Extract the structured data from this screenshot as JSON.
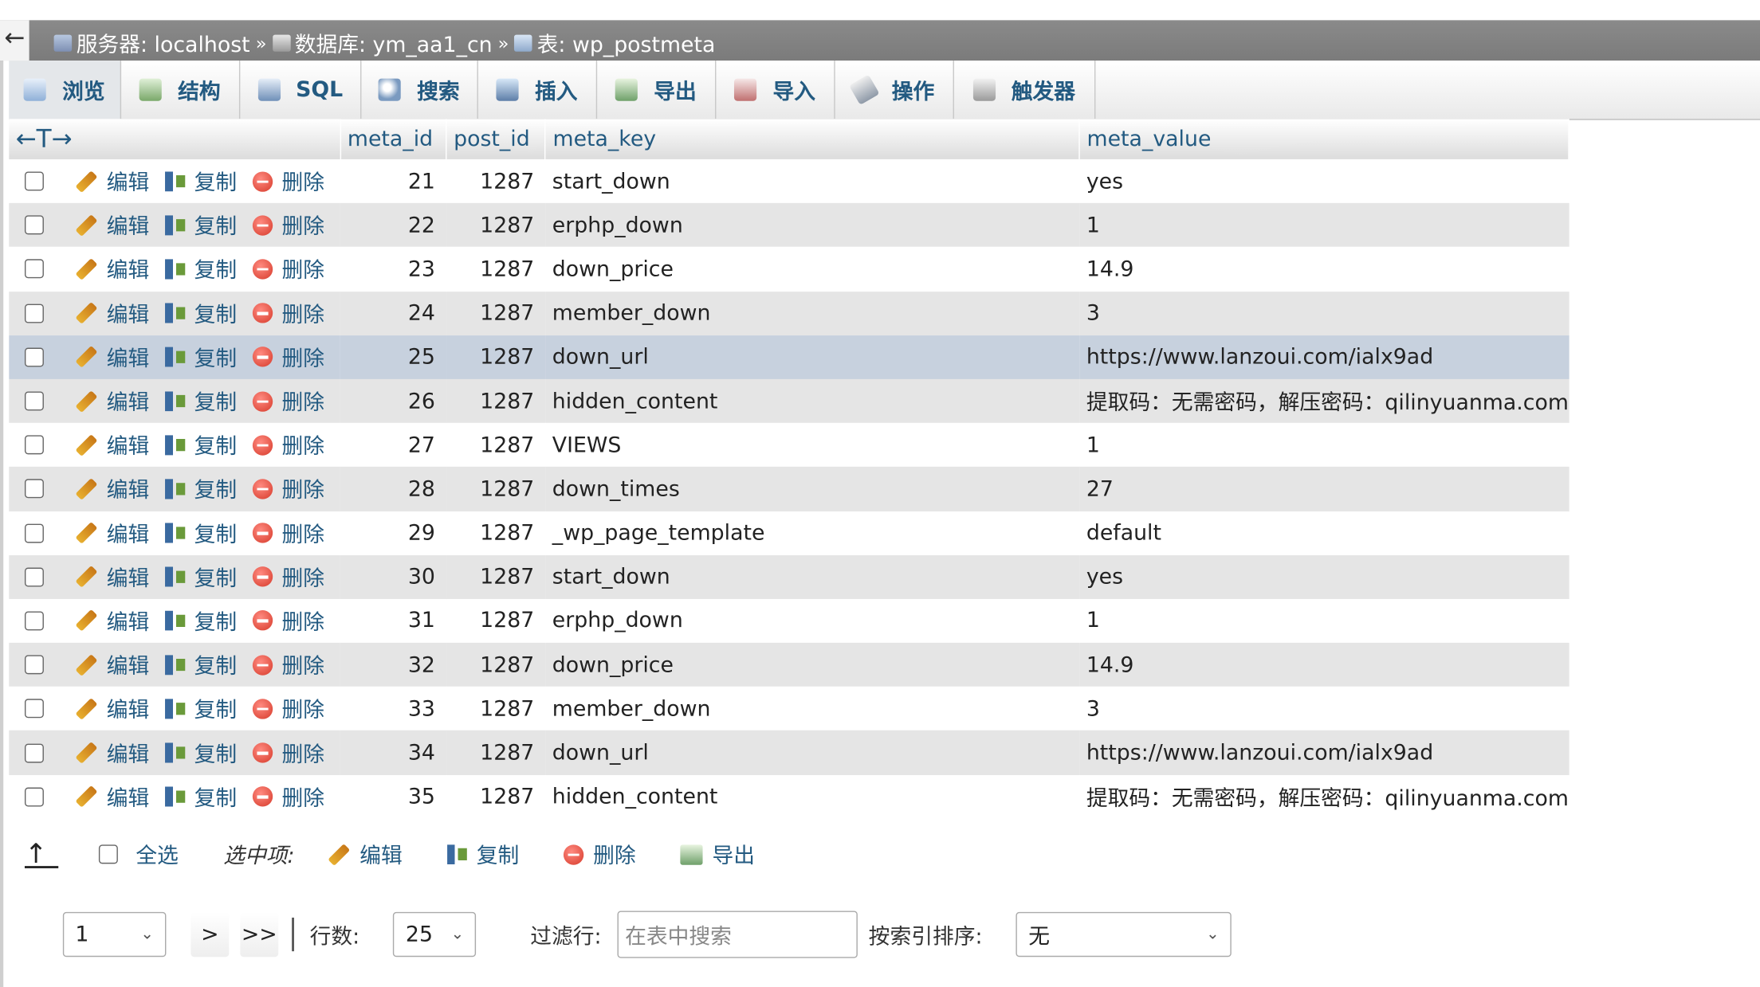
{
  "breadcrumb": {
    "back": "←",
    "server": "服务器: localhost",
    "database": "数据库: ym_aa1_cn",
    "table": "表: wp_postmeta",
    "separator": "»"
  },
  "tabs": [
    {
      "label": "浏览",
      "icon": "browse-icon"
    },
    {
      "label": "结构",
      "icon": "structure-icon"
    },
    {
      "label": "SQL",
      "icon": "sql-icon"
    },
    {
      "label": "搜索",
      "icon": "search-icon"
    },
    {
      "label": "插入",
      "icon": "insert-icon"
    },
    {
      "label": "导出",
      "icon": "export-icon"
    },
    {
      "label": "导入",
      "icon": "import-icon"
    },
    {
      "label": "操作",
      "icon": "wrench-icon"
    },
    {
      "label": "触发器",
      "icon": "trigger-icon"
    }
  ],
  "table": {
    "arrows": "←T→",
    "columns": [
      "meta_id",
      "post_id",
      "meta_key",
      "meta_value"
    ],
    "action_labels": {
      "edit": "编辑",
      "copy": "复制",
      "delete": "删除"
    },
    "rows": [
      {
        "meta_id": "21",
        "post_id": "1287",
        "meta_key": "start_down",
        "meta_value": "yes"
      },
      {
        "meta_id": "22",
        "post_id": "1287",
        "meta_key": "erphp_down",
        "meta_value": "1"
      },
      {
        "meta_id": "23",
        "post_id": "1287",
        "meta_key": "down_price",
        "meta_value": "14.9"
      },
      {
        "meta_id": "24",
        "post_id": "1287",
        "meta_key": "member_down",
        "meta_value": "3"
      },
      {
        "meta_id": "25",
        "post_id": "1287",
        "meta_key": "down_url",
        "meta_value": "https://www.lanzoui.com/ialx9ad"
      },
      {
        "meta_id": "26",
        "post_id": "1287",
        "meta_key": "hidden_content",
        "meta_value": "提取码：无需密码，解压密码：qilinyuanma.com"
      },
      {
        "meta_id": "27",
        "post_id": "1287",
        "meta_key": "VIEWS",
        "meta_value": "1"
      },
      {
        "meta_id": "28",
        "post_id": "1287",
        "meta_key": "down_times",
        "meta_value": "27"
      },
      {
        "meta_id": "29",
        "post_id": "1287",
        "meta_key": "_wp_page_template",
        "meta_value": "default"
      },
      {
        "meta_id": "30",
        "post_id": "1287",
        "meta_key": "start_down",
        "meta_value": "yes"
      },
      {
        "meta_id": "31",
        "post_id": "1287",
        "meta_key": "erphp_down",
        "meta_value": "1"
      },
      {
        "meta_id": "32",
        "post_id": "1287",
        "meta_key": "down_price",
        "meta_value": "14.9"
      },
      {
        "meta_id": "33",
        "post_id": "1287",
        "meta_key": "member_down",
        "meta_value": "3"
      },
      {
        "meta_id": "34",
        "post_id": "1287",
        "meta_key": "down_url",
        "meta_value": "https://www.lanzoui.com/ialx9ad"
      },
      {
        "meta_id": "35",
        "post_id": "1287",
        "meta_key": "hidden_content",
        "meta_value": "提取码：无需密码，解压密码：qilinyuanma.com"
      }
    ]
  },
  "bulk": {
    "select_all": "全选",
    "with_selected": "选中项:",
    "edit": "编辑",
    "copy": "复制",
    "delete": "删除",
    "export": "导出"
  },
  "nav": {
    "page": "1",
    "next": ">",
    "last": ">>",
    "rows_label": "行数:",
    "rows_value": "25",
    "filter_label": "过滤行:",
    "filter_placeholder": "在表中搜索",
    "sort_label": "按索引排序:",
    "sort_value": "无"
  },
  "colors": {
    "link": "#235a81",
    "breadcrumb_bg": "#808080",
    "row_alt": "#e5e5e5",
    "row_highlight": "#c7d1de"
  }
}
